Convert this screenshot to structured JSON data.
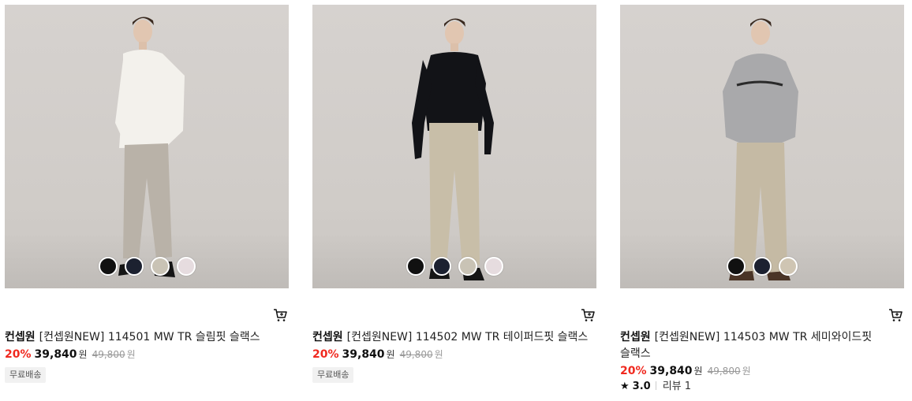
{
  "products": [
    {
      "brand": "컨셉원",
      "name": "[컨셉원NEW] 114501 MW TR 슬림핏 슬랙스",
      "discount": "20%",
      "price": "39,840",
      "price_unit": "원",
      "original_price": "49,800",
      "original_unit": "원",
      "badge": "무료배송",
      "top_color": "#f3f1ec",
      "pants_color": "#b9b2a8",
      "swatches": [
        "#111111",
        "#1c2130",
        "#c9c3b5",
        "#e6dcdf"
      ]
    },
    {
      "brand": "컨셉원",
      "name": "[컨셉원NEW] 114502 MW TR 테이퍼드핏 슬랙스",
      "discount": "20%",
      "price": "39,840",
      "price_unit": "원",
      "original_price": "49,800",
      "original_unit": "원",
      "badge": "무료배송",
      "top_color": "#121317",
      "pants_color": "#c8bea8",
      "swatches": [
        "#111111",
        "#1c2130",
        "#c9c3b5",
        "#e6dcdf"
      ]
    },
    {
      "brand": "컨셉원",
      "name": "[컨셉원NEW] 114503 MW TR 세미와이드핏 슬랙스",
      "discount": "20%",
      "price": "39,840",
      "price_unit": "원",
      "original_price": "49,800",
      "original_unit": "원",
      "rating_icon": "star-icon",
      "rating": "3.0",
      "review_label": "리뷰 1",
      "top_color": "#a9a9ab",
      "pants_color": "#c5baa4",
      "swatches": [
        "#111111",
        "#1c2130",
        "#cfc5b3"
      ]
    }
  ],
  "icons": {
    "cart": "cart-icon"
  }
}
